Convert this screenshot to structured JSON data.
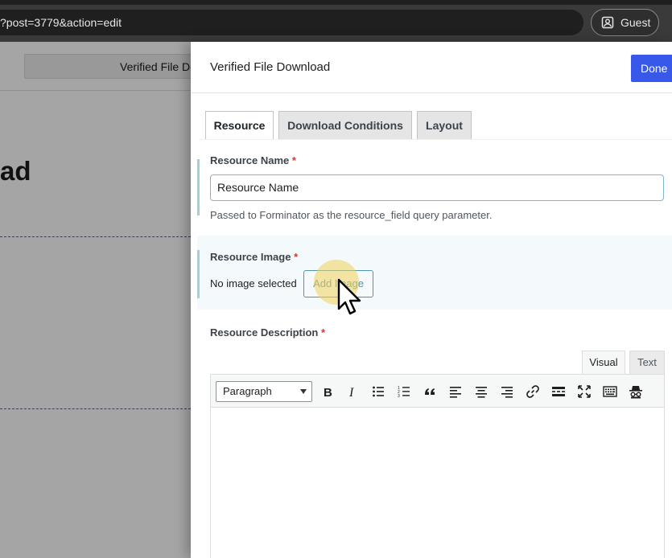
{
  "browser": {
    "url": "?post=3779&action=edit",
    "profile_label": "Guest"
  },
  "background_page": {
    "tab_label": "Verified File Download",
    "heading": "ad"
  },
  "panel": {
    "title": "Verified File Download",
    "done_label": "Done",
    "tabs": [
      {
        "label": "Resource"
      },
      {
        "label": "Download Conditions"
      },
      {
        "label": "Layout"
      }
    ],
    "resource_name": {
      "label": "Resource Name",
      "required_mark": "*",
      "value": "Resource Name",
      "help": "Passed to Forminator as the resource_field query parameter."
    },
    "resource_image": {
      "label": "Resource Image",
      "required_mark": "*",
      "status": "No image selected",
      "button_label": "Add Image"
    },
    "resource_description": {
      "label": "Resource Description",
      "required_mark": "*",
      "editor_tabs": [
        {
          "label": "Visual"
        },
        {
          "label": "Text"
        }
      ],
      "format_value": "Paragraph"
    }
  },
  "colors": {
    "accent": "#3858e9",
    "required": "#d63638",
    "highlight": "#a3cedd"
  },
  "icons": {
    "toolbar": [
      "bold-icon",
      "italic-icon",
      "bullet-list-icon",
      "numbered-list-icon",
      "blockquote-icon",
      "align-left-icon",
      "align-center-icon",
      "align-right-icon",
      "link-icon",
      "read-more-icon",
      "fullscreen-icon",
      "keyboard-icon",
      "incognito-icon"
    ]
  }
}
